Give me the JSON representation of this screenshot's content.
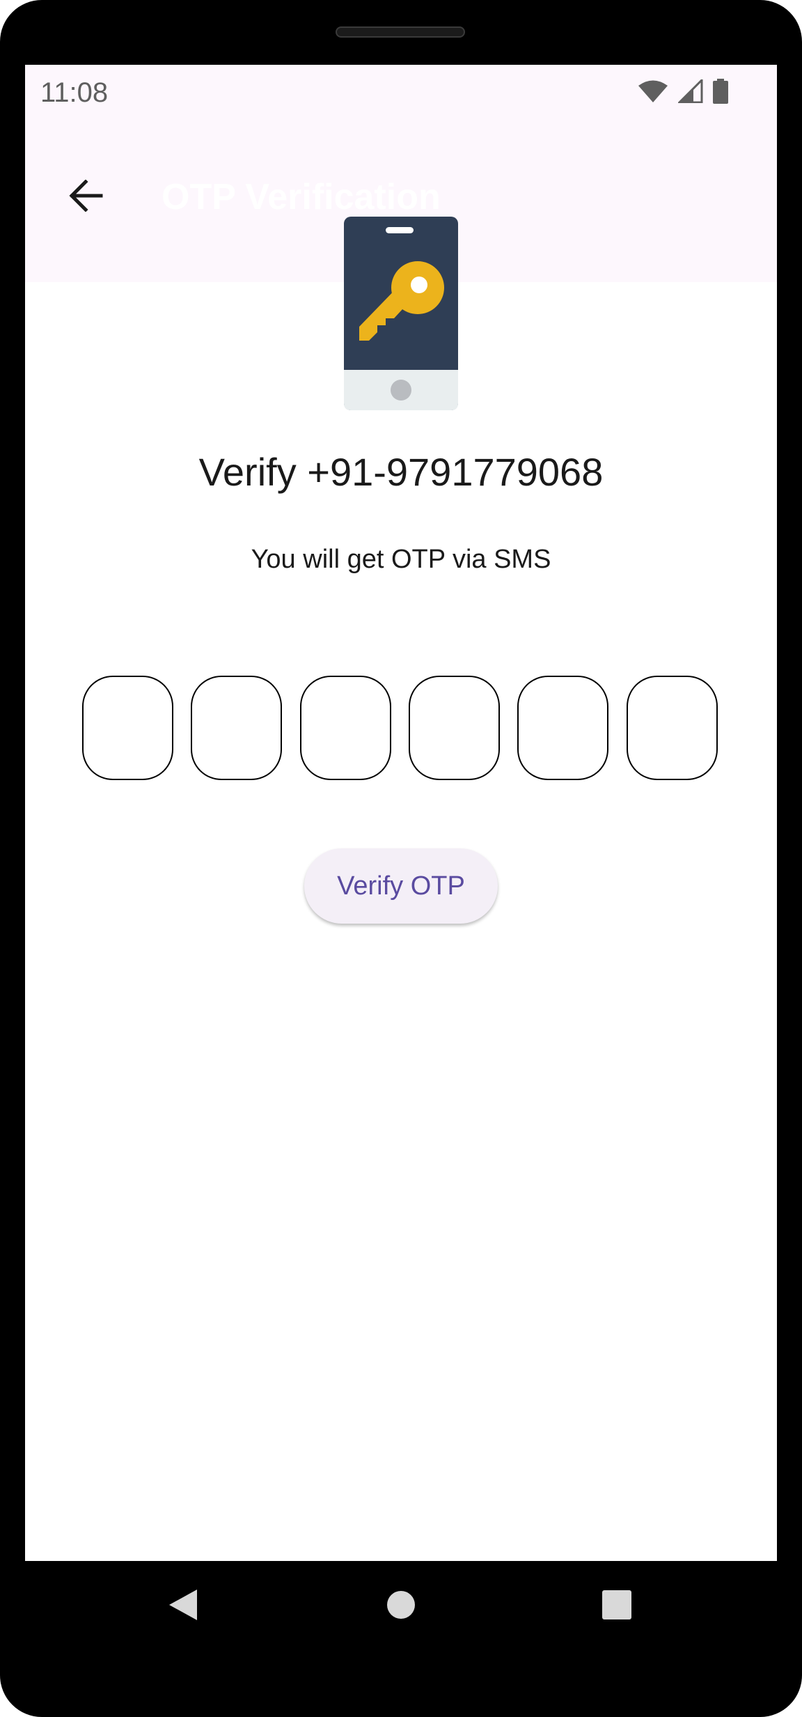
{
  "status_bar": {
    "time": "11:08",
    "icons": [
      "wifi-icon",
      "cell-signal-icon",
      "battery-icon"
    ]
  },
  "app_bar": {
    "title": "OTP Verification",
    "back_icon": "arrow-left-icon"
  },
  "illustration": {
    "icon": "phone-key-icon"
  },
  "main": {
    "heading": "Verify +91-9791779068",
    "subheading": "You will get OTP via SMS",
    "otp_digits": [
      "",
      "",
      "",
      "",
      "",
      ""
    ],
    "verify_button": "Verify OTP"
  },
  "nav_bar": {
    "items": [
      "back-triangle-icon",
      "home-circle-icon",
      "recents-square-icon"
    ]
  },
  "colors": {
    "app_bar_bg": "#fdf7fd",
    "button_bg": "#f4eff7",
    "button_text": "#5a4ba0",
    "illustration_phone": "#2f3e55",
    "illustration_key": "#ecb31c"
  }
}
